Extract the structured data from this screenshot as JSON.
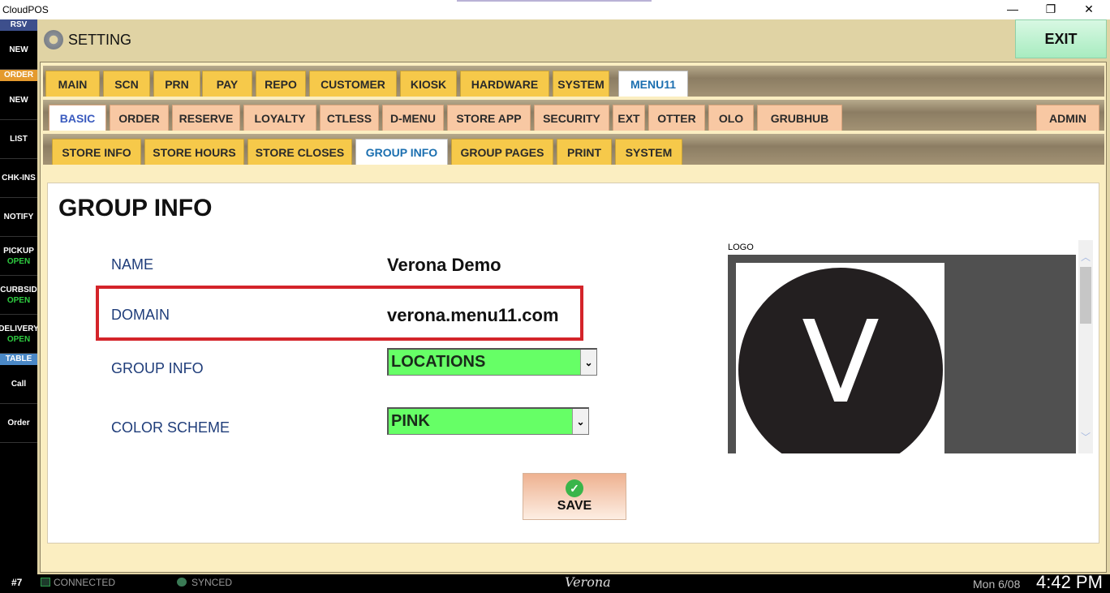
{
  "window": {
    "title": "CloudPOS",
    "minimize": "—",
    "maximize": "❐",
    "close": "✕"
  },
  "sidebar": {
    "sections": [
      {
        "header": "RSV",
        "header_color": "#3d4f8c",
        "items": [
          {
            "label": "NEW",
            "status": ""
          }
        ]
      },
      {
        "header": "ORDER",
        "header_color": "#e49a2e",
        "items": [
          {
            "label": "NEW",
            "status": ""
          },
          {
            "label": "LIST",
            "status": ""
          },
          {
            "label": "CHK-INS",
            "status": ""
          },
          {
            "label": "NOTIFY",
            "status": ""
          },
          {
            "label": "PICKUP",
            "status": "OPEN"
          },
          {
            "label": "CURBSID",
            "status": "OPEN"
          },
          {
            "label": "DELIVERY",
            "status": "OPEN"
          }
        ]
      },
      {
        "header": "TABLE",
        "header_color": "#4a88c6",
        "items": [
          {
            "label": "Call",
            "status": ""
          },
          {
            "label": "Order",
            "status": ""
          }
        ]
      }
    ]
  },
  "header": {
    "title": "SETTING",
    "exit_label": "EXIT"
  },
  "tabs_level1": [
    "MAIN",
    "SCN",
    "PRN",
    "PAY",
    "REPO",
    "CUSTOMER",
    "KIOSK",
    "HARDWARE",
    "SYSTEM",
    "MENU11"
  ],
  "tabs_level1_selected": 9,
  "tabs_level2": [
    "BASIC",
    "ORDER",
    "RESERVE",
    "LOYALTY",
    "CTLESS",
    "D-MENU",
    "STORE APP",
    "SECURITY",
    "EXT",
    "OTTER",
    "OLO",
    "GRUBHUB"
  ],
  "tabs_level2_selected": 0,
  "tabs_level2_right": "ADMIN",
  "tabs_level3": [
    "STORE INFO",
    "STORE HOURS",
    "STORE CLOSES",
    "GROUP INFO",
    "GROUP PAGES",
    "PRINT",
    "SYSTEM"
  ],
  "tabs_level3_selected": 3,
  "content": {
    "heading": "GROUP INFO",
    "name_label": "NAME",
    "name_value": "Verona Demo",
    "domain_label": "DOMAIN",
    "domain_value": "verona.menu11.com",
    "group_info_label": "GROUP INFO",
    "group_info_value": "LOCATIONS",
    "color_scheme_label": "COLOR SCHEME",
    "color_scheme_value": "PINK",
    "logo_label": "LOGO",
    "logo_letter": "V",
    "save_label": "SAVE"
  },
  "statusbar": {
    "workstation": "#7",
    "connection": "CONNECTED",
    "sync": "SYNCED",
    "brand": "Verona",
    "date": "Mon 6/08",
    "time": "4:42 PM"
  }
}
